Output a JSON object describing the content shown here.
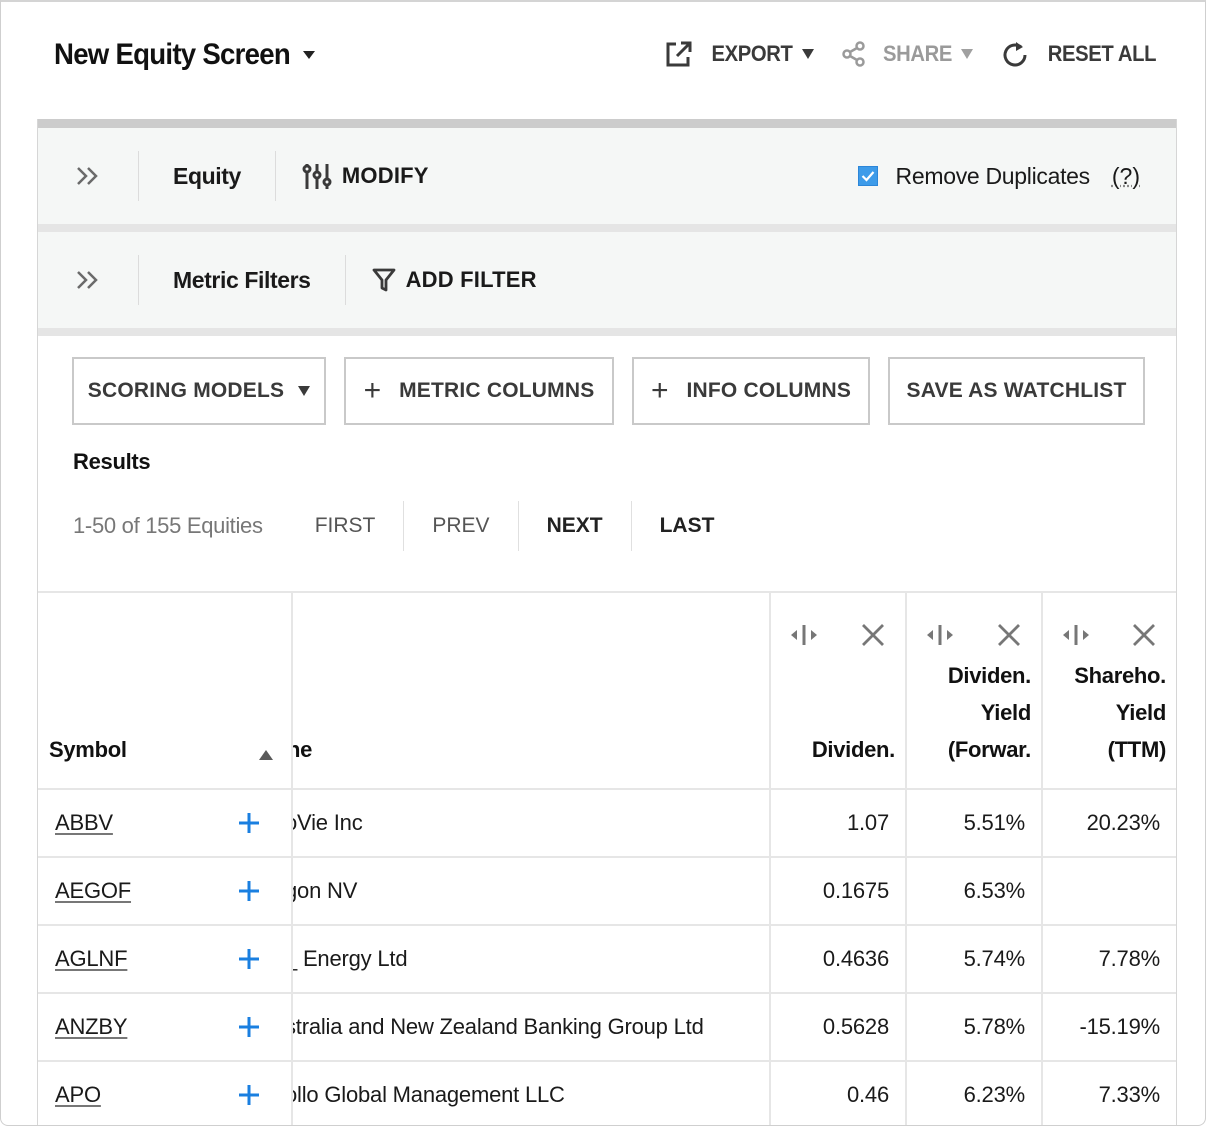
{
  "header": {
    "title": "New Equity Screen",
    "actions": {
      "export": "EXPORT",
      "share": "SHARE",
      "reset": "RESET ALL"
    }
  },
  "universe": {
    "label": "Equity",
    "modify": "MODIFY",
    "remove_duplicates_label": "Remove Duplicates",
    "remove_duplicates_checked": true,
    "help": "(?)"
  },
  "filters": {
    "label": "Metric Filters",
    "add_filter": "ADD FILTER"
  },
  "toolbar": {
    "scoring_models": "SCORING MODELS",
    "metric_columns": "METRIC COLUMNS",
    "info_columns": "INFO COLUMNS",
    "save_watchlist": "SAVE AS WATCHLIST"
  },
  "results": {
    "heading": "Results",
    "count": "1-50 of 155 Equities",
    "pager": {
      "first": "FIRST",
      "prev": "PREV",
      "next": "NEXT",
      "last": "LAST"
    }
  },
  "table": {
    "columns": {
      "symbol": "Symbol",
      "name": "Name",
      "name_visible": "ne",
      "dividend": "Dividen.",
      "dividend_yield": [
        "Dividen.",
        "Yield",
        "(Forwar."
      ],
      "shareholder_yield": [
        "Shareho.",
        "Yield",
        "(TTM)"
      ]
    },
    "sort": {
      "column": "Symbol",
      "direction": "ascending"
    },
    "rows": [
      {
        "symbol": "ABBV",
        "name_visible": "oVie Inc",
        "dividend": "1.07",
        "dividend_yield": "5.51%",
        "shareholder_yield": "20.23%"
      },
      {
        "symbol": "AEGOF",
        "name_visible": "gon NV",
        "dividend": "0.1675",
        "dividend_yield": "6.53%",
        "shareholder_yield": ""
      },
      {
        "symbol": "AGLNF",
        "name_visible": "_ Energy Ltd",
        "dividend": "0.4636",
        "dividend_yield": "5.74%",
        "shareholder_yield": "7.78%"
      },
      {
        "symbol": "ANZBY",
        "name_visible": "stralia and New Zealand Banking Group Ltd",
        "dividend": "0.5628",
        "dividend_yield": "5.78%",
        "shareholder_yield": "-15.19%"
      },
      {
        "symbol": "APO",
        "name_visible": "ollo Global Management LLC",
        "dividend": "0.46",
        "dividend_yield": "6.23%",
        "shareholder_yield": "7.33%"
      }
    ]
  },
  "colors": {
    "accent_blue": "#1a7fe0",
    "checkbox_blue": "#3d9be9",
    "strip_bg": "#f5f7f6",
    "text_dark": "#1a1a1a",
    "text_muted": "#777777"
  }
}
